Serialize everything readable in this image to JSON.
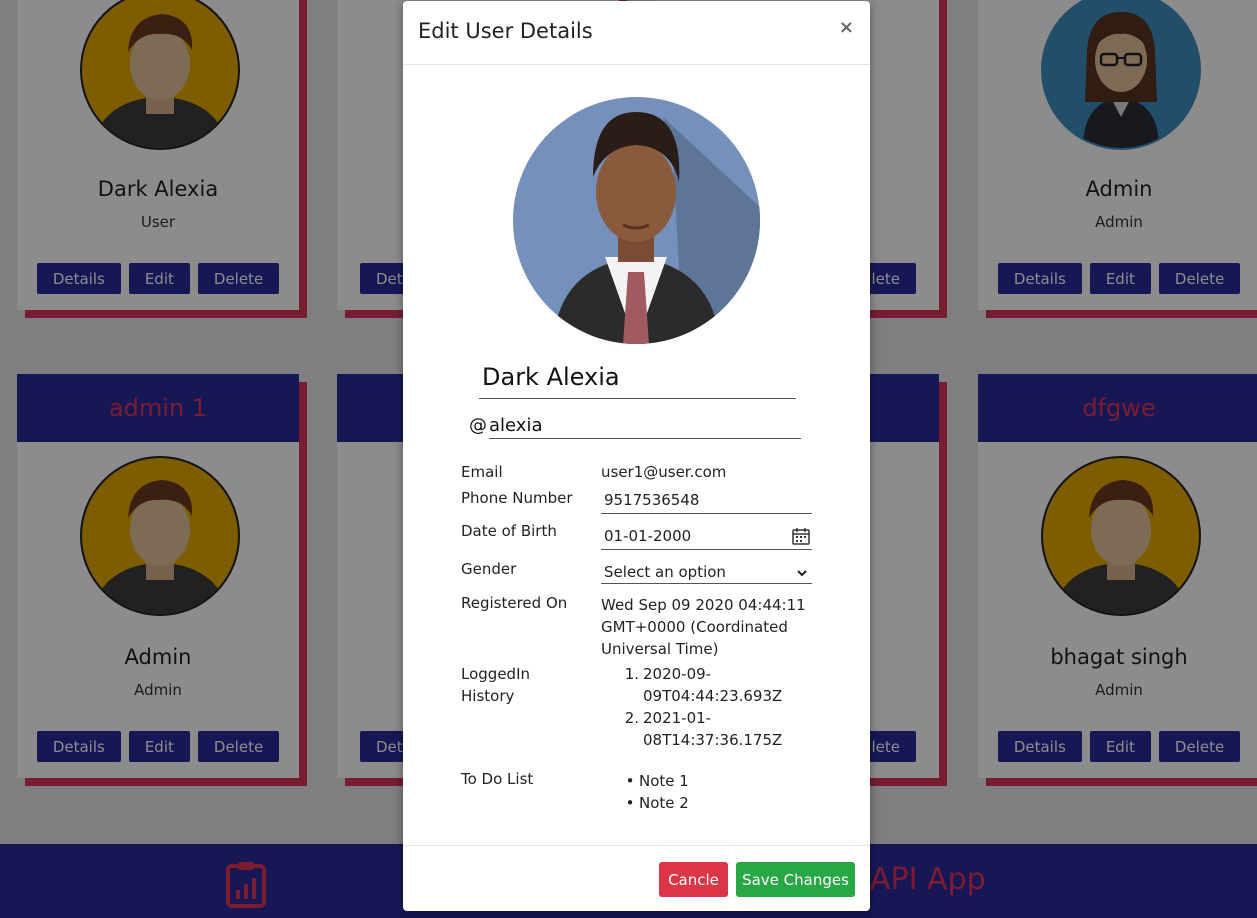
{
  "colors": {
    "navy": "#2a2a9d",
    "accent": "#e0335a",
    "cancel": "#dc3545",
    "save": "#28a745"
  },
  "background": {
    "cards": [
      {
        "name": "Dark Alexia",
        "role": "User",
        "avatar": "male-avatar-icon"
      },
      {
        "name": "Admin",
        "role": "Admin",
        "avatar": "female-avatar-icon"
      },
      {
        "header": "admin 1",
        "name": "Admin",
        "role": "Admin",
        "avatar": "male-avatar-icon"
      },
      {
        "header": "dfgwe",
        "name": "bhagat singh",
        "role": "Admin",
        "avatar": "male-avatar-icon"
      }
    ],
    "buttons": {
      "details": "Details",
      "edit": "Edit",
      "delete": "Delete"
    },
    "partial_buttons": {
      "left": "Det",
      "right": "lete"
    },
    "footer": {
      "title": "API App",
      "icon": "clipboard-chart-icon"
    }
  },
  "modal": {
    "title": "Edit User Details",
    "close": "×",
    "avatar": "businessman-avatar-icon",
    "name": "Dark Alexia",
    "at": "@",
    "username": "alexia",
    "fields": {
      "email_label": "Email",
      "email": "user1@user.com",
      "phone_label": "Phone Number",
      "phone": "9517536548",
      "dob_label": "Date of Birth",
      "dob": "01-01-2000",
      "gender_label": "Gender",
      "gender": "Select an option",
      "registered_label": "Registered On",
      "registered": [
        "Wed Sep 09 2020 04:44:11",
        "GMT+0000 (Coordinated",
        "Universal Time)"
      ],
      "loggedin_label": [
        "LoggedIn",
        "History"
      ],
      "loggedin": [
        {
          "n": "1.",
          "lines": [
            "2020-09-",
            "09T04:44:23.693Z"
          ]
        },
        {
          "n": "2.",
          "lines": [
            "2021-01-",
            "08T14:37:36.175Z"
          ]
        }
      ],
      "todo_label": "To Do List",
      "todo": [
        "Note 1",
        "Note 2"
      ]
    },
    "buttons": {
      "cancel": "Cancle",
      "save": "Save Changes"
    }
  }
}
